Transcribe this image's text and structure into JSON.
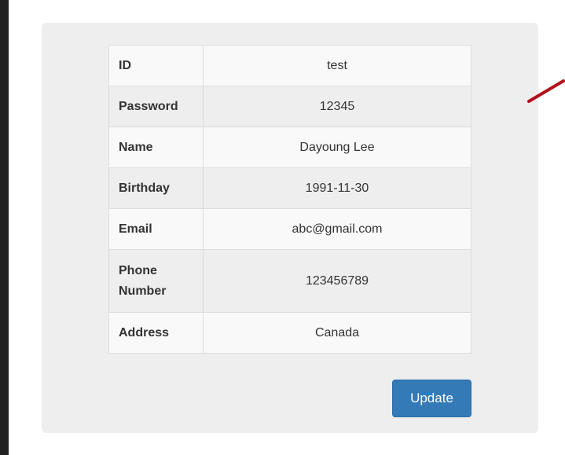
{
  "user_info": {
    "rows": [
      {
        "label": "ID",
        "value": "test"
      },
      {
        "label": "Password",
        "value": "12345"
      },
      {
        "label": "Name",
        "value": "Dayoung Lee"
      },
      {
        "label": "Birthday",
        "value": "1991-11-30"
      },
      {
        "label": "Email",
        "value": "abc@gmail.com"
      },
      {
        "label": "Phone Number",
        "value": "123456789"
      },
      {
        "label": "Address",
        "value": "Canada"
      }
    ]
  },
  "actions": {
    "update_label": "Update"
  },
  "colors": {
    "button_primary": "#337ab7",
    "annotation_arrow": "#b3121b",
    "card_background": "#eeeeee"
  }
}
